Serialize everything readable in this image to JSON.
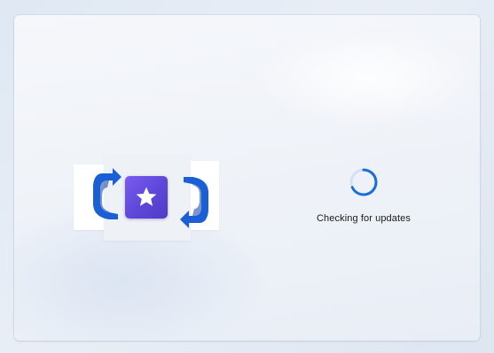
{
  "window": {
    "illustration": {
      "icons": [
        "sync-arrow-left-icon",
        "star-app-icon",
        "sync-arrow-right-icon"
      ],
      "tile_color": "#5d47d8",
      "arrow_color": "#1a5fd6"
    },
    "progress": {
      "icon": "loading-spinner-icon",
      "status_text": "Checking for updates",
      "spinner_color": "#1a6fd6"
    }
  }
}
